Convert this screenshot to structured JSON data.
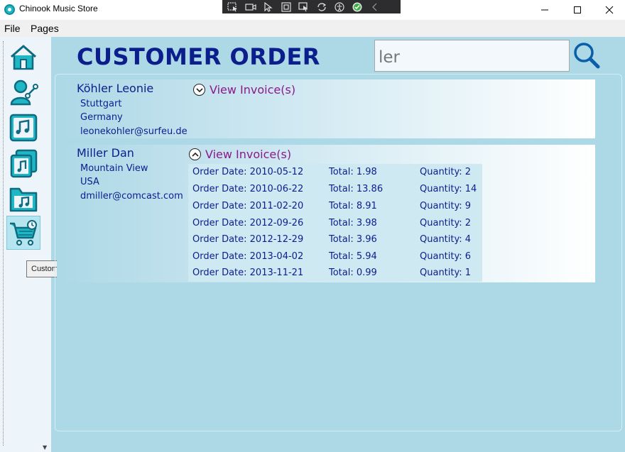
{
  "window": {
    "title": "Chinook Music Store"
  },
  "menu": {
    "items": [
      "File",
      "Pages"
    ]
  },
  "nav": {
    "items": [
      {
        "icon": "home-icon"
      },
      {
        "icon": "artist-icon"
      },
      {
        "icon": "music-note-icon"
      },
      {
        "icon": "album-icon"
      },
      {
        "icon": "music-folder-icon"
      },
      {
        "icon": "shopping-cart-icon"
      }
    ],
    "selected_index": 5,
    "tooltip": "Customer Orders"
  },
  "header": {
    "title": "CUSTOMER ORDER"
  },
  "search": {
    "value": "ler"
  },
  "customers": [
    {
      "name": "Köhler Leonie",
      "city": "Stuttgart",
      "country": "Germany",
      "email": "leonekohler@surfeu.de",
      "toggle_label": "View Invoice(s)",
      "expanded": false,
      "orders": []
    },
    {
      "name": "Miller Dan",
      "city": "Mountain View",
      "country": "USA",
      "email": "dmiller@comcast.com",
      "toggle_label": "View Invoice(s)",
      "expanded": true,
      "orders": [
        {
          "date": "Order Date: 2010-05-12",
          "total": "Total: 1.98",
          "quantity": "Quantity: 2"
        },
        {
          "date": "Order Date: 2010-06-22",
          "total": "Total: 13.86",
          "quantity": "Quantity: 14"
        },
        {
          "date": "Order Date: 2011-02-20",
          "total": "Total: 8.91",
          "quantity": "Quantity: 9"
        },
        {
          "date": "Order Date: 2012-09-26",
          "total": "Total: 3.98",
          "quantity": "Quantity: 2"
        },
        {
          "date": "Order Date: 2012-12-29",
          "total": "Total: 3.96",
          "quantity": "Quantity: 4"
        },
        {
          "date": "Order Date: 2013-04-02",
          "total": "Total: 5.94",
          "quantity": "Quantity: 6"
        },
        {
          "date": "Order Date: 2013-11-21",
          "total": "Total: 0.99",
          "quantity": "Quantity: 1"
        }
      ]
    }
  ],
  "colors": {
    "background": "#add8e6",
    "title": "#0b1e8c",
    "link": "#8a1a8a",
    "accent": "#1fb7c6"
  }
}
